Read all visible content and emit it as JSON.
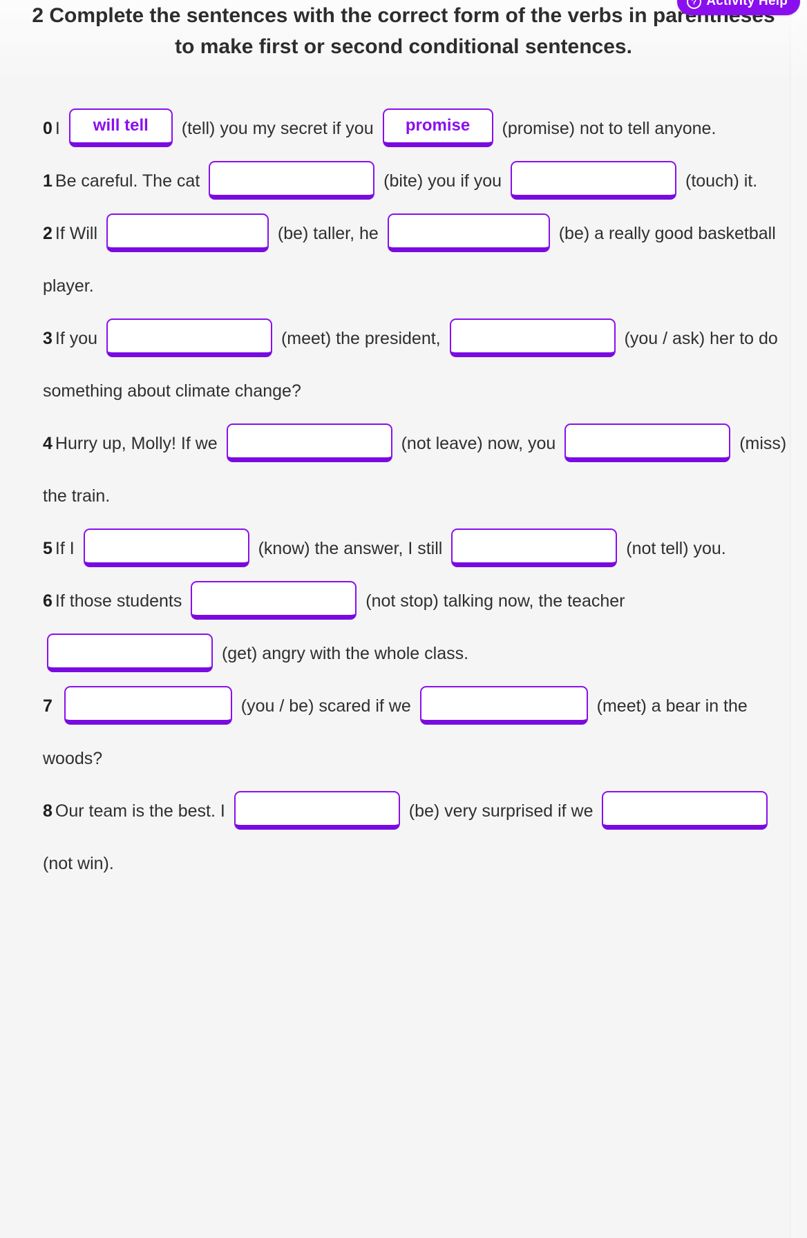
{
  "theme": {
    "accent": "#8A0FEE",
    "accent_shadow": "#7A0BE0",
    "page_bg": "#f5f5f6",
    "text": "#2f2f2f"
  },
  "activity_help": {
    "label": "Activity Help",
    "icon": "help-circle-icon"
  },
  "instruction": {
    "number": "2",
    "text": "Complete the sentences with the correct form of the verbs in parentheses to make first or second conditional sentences."
  },
  "exercise": {
    "items": [
      {
        "number": "0",
        "segments": [
          {
            "kind": "text",
            "value": "I "
          },
          {
            "kind": "box",
            "value": "will tell",
            "width": "w150"
          },
          {
            "kind": "text",
            "value": " (tell) you my secret if you "
          },
          {
            "kind": "box",
            "value": "promise",
            "width": "w160"
          },
          {
            "kind": "text",
            "value": " (promise) not to tell anyone."
          }
        ]
      },
      {
        "number": "1",
        "segments": [
          {
            "kind": "text",
            "value": "Be careful. The cat "
          },
          {
            "kind": "box",
            "value": "",
            "width": "w240"
          },
          {
            "kind": "text",
            "value": " (bite) you if you "
          },
          {
            "kind": "box",
            "value": "",
            "width": "w240"
          },
          {
            "kind": "text",
            "value": " (touch) it."
          }
        ]
      },
      {
        "number": "2",
        "segments": [
          {
            "kind": "text",
            "value": "If Will "
          },
          {
            "kind": "box",
            "value": "",
            "width": "w235"
          },
          {
            "kind": "text",
            "value": " (be) taller, he "
          },
          {
            "kind": "box",
            "value": "",
            "width": "w235"
          },
          {
            "kind": "text",
            "value": " (be) a really good basketball player."
          }
        ]
      },
      {
        "number": "3",
        "segments": [
          {
            "kind": "text",
            "value": "If you "
          },
          {
            "kind": "box",
            "value": "",
            "width": "w240"
          },
          {
            "kind": "text",
            "value": " (meet) the president, "
          },
          {
            "kind": "box",
            "value": "",
            "width": "w240"
          },
          {
            "kind": "text",
            "value": " (you / ask) her to do something about climate change?"
          }
        ]
      },
      {
        "number": "4",
        "segments": [
          {
            "kind": "text",
            "value": "Hurry up, Molly! If we "
          },
          {
            "kind": "box",
            "value": "",
            "width": "w240"
          },
          {
            "kind": "text",
            "value": " (not leave) now, you "
          },
          {
            "kind": "box",
            "value": "",
            "width": "w240"
          },
          {
            "kind": "text",
            "value": " (miss) the train."
          }
        ]
      },
      {
        "number": "5",
        "segments": [
          {
            "kind": "text",
            "value": "If I "
          },
          {
            "kind": "box",
            "value": "",
            "width": "w240"
          },
          {
            "kind": "text",
            "value": " (know) the answer, I still "
          },
          {
            "kind": "box",
            "value": "",
            "width": "w240"
          },
          {
            "kind": "text",
            "value": " (not tell) you."
          }
        ]
      },
      {
        "number": "6",
        "segments": [
          {
            "kind": "text",
            "value": "If those students "
          },
          {
            "kind": "box",
            "value": "",
            "width": "w240"
          },
          {
            "kind": "text",
            "value": " (not stop) talking now, the teacher "
          },
          {
            "kind": "box",
            "value": "",
            "width": "w240"
          },
          {
            "kind": "text",
            "value": " (get) angry with the whole class."
          }
        ]
      },
      {
        "number": "7",
        "segments": [
          {
            "kind": "text",
            "value": " "
          },
          {
            "kind": "box",
            "value": "",
            "width": "w243"
          },
          {
            "kind": "text",
            "value": " (you / be) scared if we "
          },
          {
            "kind": "box",
            "value": "",
            "width": "w243"
          },
          {
            "kind": "text",
            "value": " (meet) a bear in the woods?"
          }
        ]
      },
      {
        "number": "8",
        "segments": [
          {
            "kind": "text",
            "value": "Our team is the best. I "
          },
          {
            "kind": "box",
            "value": "",
            "width": "w240"
          },
          {
            "kind": "text",
            "value": " (be) very surprised if we "
          },
          {
            "kind": "box",
            "value": "",
            "width": "w240"
          },
          {
            "kind": "text",
            "value": " (not win)."
          }
        ]
      }
    ]
  }
}
